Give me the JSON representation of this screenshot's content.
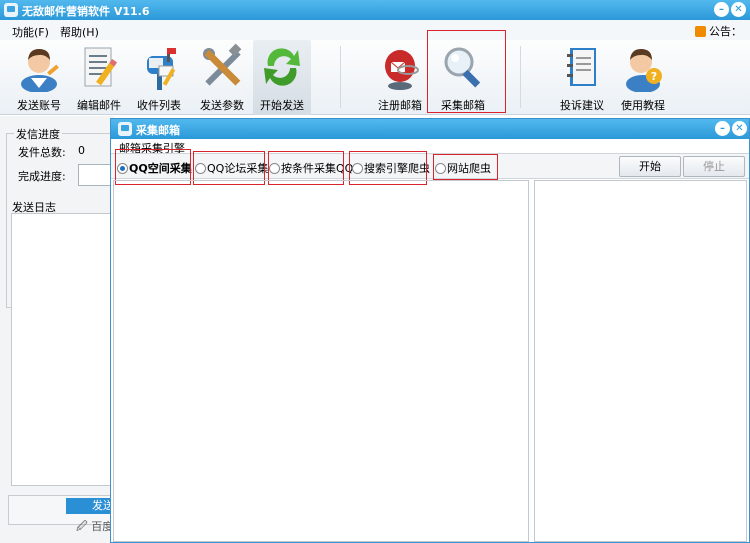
{
  "app": {
    "title": "无敌邮件营销软件   V11.6"
  },
  "menu": {
    "function": "功能(F)",
    "help": "帮助(H)",
    "notice": "公告："
  },
  "toolbar": [
    {
      "label": "发送账号",
      "icon": "user-avatar-icon"
    },
    {
      "label": "编辑邮件",
      "icon": "document-edit-icon"
    },
    {
      "label": "收件列表",
      "icon": "mailbox-icon"
    },
    {
      "label": "发送参数",
      "icon": "tools-icon"
    },
    {
      "label": "开始发送",
      "icon": "refresh-arrows-icon"
    },
    {
      "label": "注册邮箱",
      "icon": "register-mail-icon"
    },
    {
      "label": "采集邮箱",
      "icon": "magnifier-icon"
    },
    {
      "label": "投诉建议",
      "icon": "notebook-icon"
    },
    {
      "label": "使用教程",
      "icon": "help-user-icon"
    }
  ],
  "left": {
    "group_title": "发信进度",
    "total_label": "发件总数:",
    "total_value": "0",
    "progress_label": "完成进度:",
    "log_title": "发送日志",
    "send_button": "发送",
    "baidu": "百度"
  },
  "dialog": {
    "title": "采集邮箱",
    "engine_label": "邮箱采集引擎",
    "options": [
      "QQ空间采集",
      "QQ论坛采集",
      "按条件采集QQ",
      "搜索引擎爬虫",
      "网站爬虫"
    ],
    "selected": "QQ空间采集",
    "start_button": "开始",
    "stop_button": "停止"
  },
  "colors": {
    "titlebar": "#2b98d8",
    "highlight": "#d9232e"
  }
}
